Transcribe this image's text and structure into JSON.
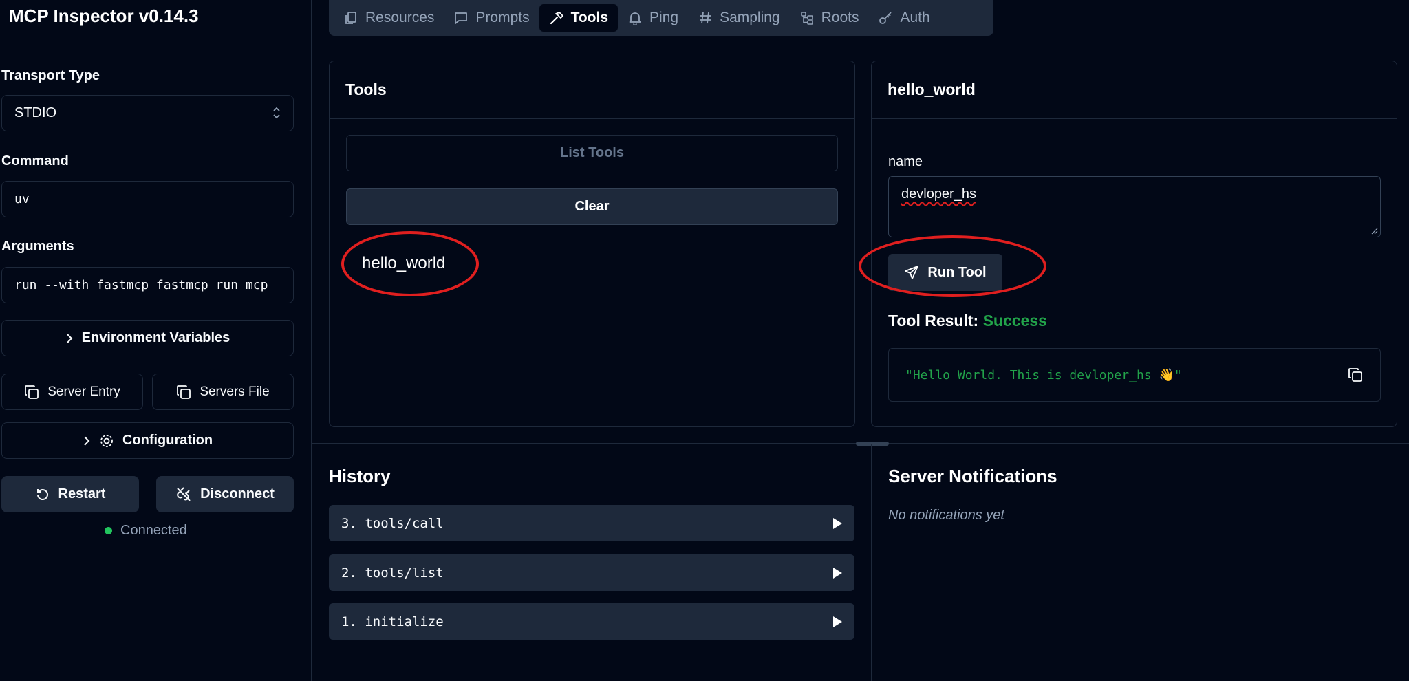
{
  "app": {
    "title": "MCP Inspector v0.14.3"
  },
  "sidebar": {
    "transport_label": "Transport Type",
    "transport_value": "STDIO",
    "command_label": "Command",
    "command_value": "uv",
    "arguments_label": "Arguments",
    "arguments_value": "run --with fastmcp fastmcp run mcp",
    "env_vars_label": "Environment Variables",
    "server_entry_label": "Server Entry",
    "servers_file_label": "Servers File",
    "configuration_label": "Configuration",
    "restart_label": "Restart",
    "disconnect_label": "Disconnect",
    "status_text": "Connected"
  },
  "tabs": [
    {
      "label": "Resources",
      "icon": "file-icon"
    },
    {
      "label": "Prompts",
      "icon": "message-icon"
    },
    {
      "label": "Tools",
      "icon": "hammer-icon",
      "active": true
    },
    {
      "label": "Ping",
      "icon": "bell-icon"
    },
    {
      "label": "Sampling",
      "icon": "hash-icon"
    },
    {
      "label": "Roots",
      "icon": "folder-tree-icon"
    },
    {
      "label": "Auth",
      "icon": "key-icon"
    }
  ],
  "tools_panel": {
    "title": "Tools",
    "list_button": "List Tools",
    "clear_button": "Clear",
    "items": [
      "hello_world"
    ]
  },
  "tool_detail": {
    "title": "hello_world",
    "param_label": "name",
    "param_value": "devloper_hs",
    "run_button": "Run Tool",
    "result_label": "Tool Result:",
    "result_status": "Success",
    "result_text": "\"Hello World. This is devloper_hs 👋\""
  },
  "history": {
    "title": "History",
    "items": [
      "3. tools/call",
      "2. tools/list",
      "1. initialize"
    ]
  },
  "notifications": {
    "title": "Server Notifications",
    "empty_text": "No notifications yet"
  },
  "colors": {
    "background": "#020817",
    "panel": "#1e293b",
    "success": "#22a34a",
    "annotation": "#e01f1f"
  }
}
